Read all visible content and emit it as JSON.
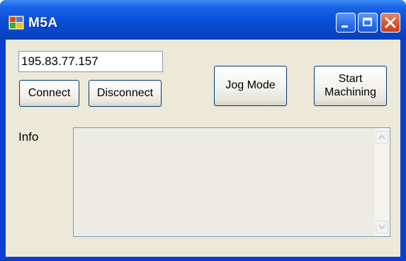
{
  "window": {
    "title": "M5A",
    "icon": "app-window-icon",
    "controls": [
      "minimize-icon",
      "maximize-icon",
      "close-icon"
    ]
  },
  "connection": {
    "ip_value": "195.83.77.157",
    "connect_label": "Connect",
    "disconnect_label": "Disconnect"
  },
  "actions": {
    "jog_label": "Jog Mode",
    "start_line1": "Start",
    "start_line2": "Machining"
  },
  "info": {
    "label": "Info",
    "text": ""
  },
  "colors": {
    "titlebar": "#0a50d8",
    "client_bg": "#ece9d8",
    "close_button": "#d9542f"
  }
}
